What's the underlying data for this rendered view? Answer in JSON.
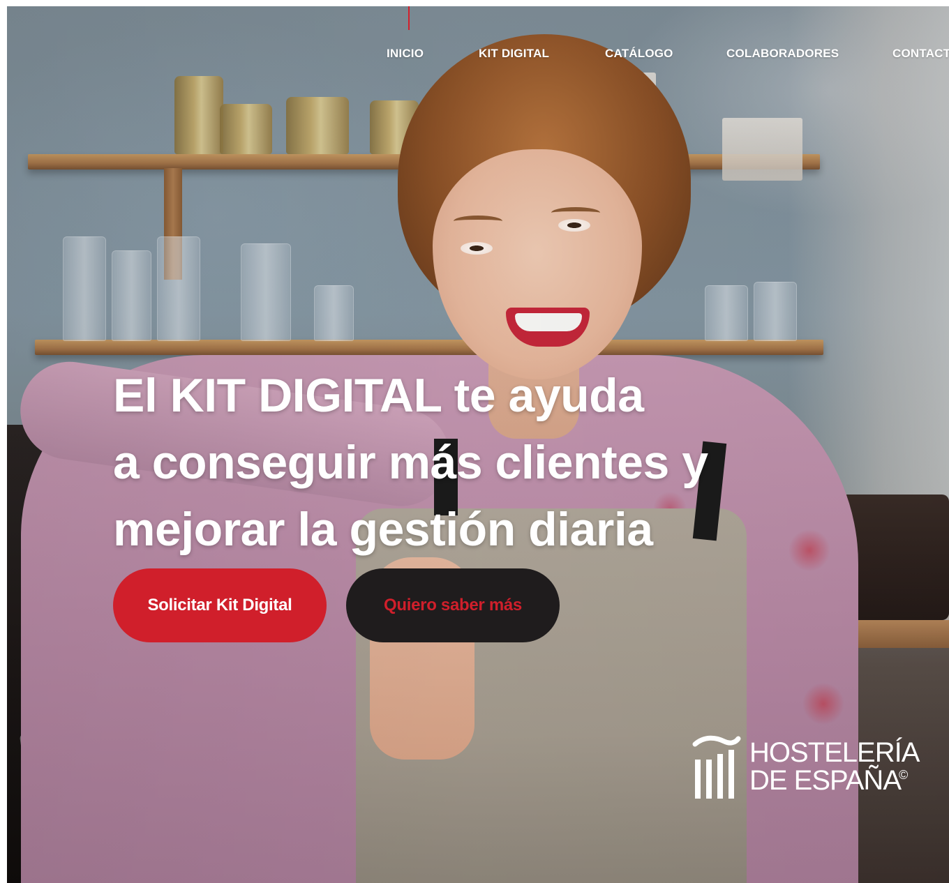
{
  "nav": {
    "items": [
      {
        "label": "INICIO"
      },
      {
        "label": "KIT DIGITAL"
      },
      {
        "label": "CATÁLOGO"
      },
      {
        "label": "COLABORADORES"
      },
      {
        "label": "CONTACT"
      }
    ]
  },
  "hero": {
    "headline_lines": [
      "El KIT DIGITAL te ayuda",
      "a conseguir más clientes y",
      "mejorar la gestión diaria"
    ],
    "primary_button": "Solicitar Kit Digital",
    "secondary_button": "Quiero saber más"
  },
  "logo": {
    "line1": "HOSTELERÍA",
    "line2": "DE ESPAÑA",
    "copyright": "©"
  },
  "colors": {
    "accent_red": "#d01f2b",
    "dark_button": "#1f1c1d",
    "text_white": "#ffffff"
  },
  "icons": {
    "logo_mark": "hosteleria-columns-logo-icon"
  }
}
